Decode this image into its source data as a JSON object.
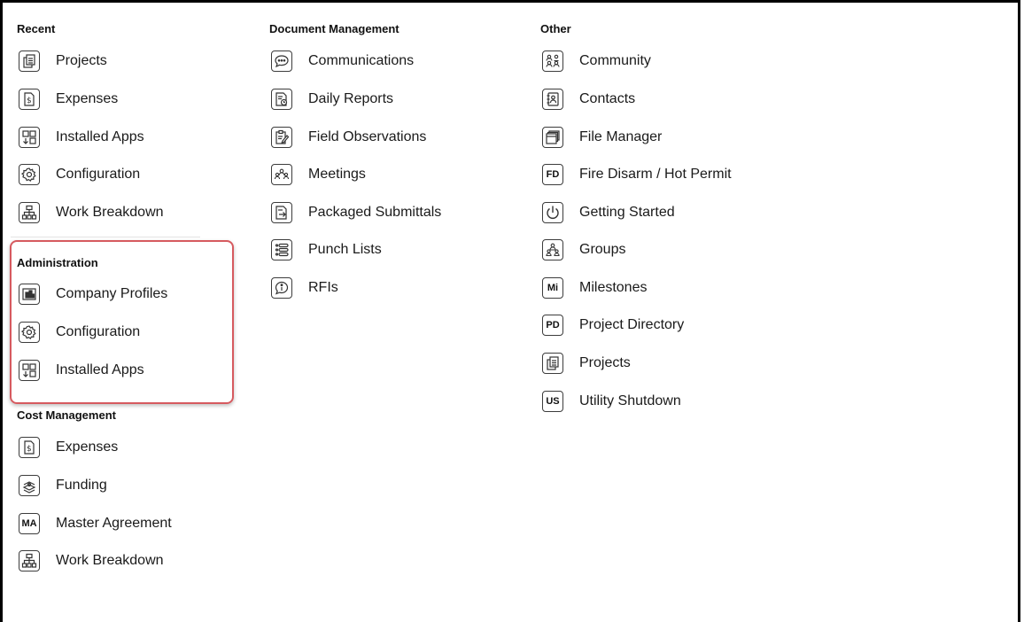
{
  "columns": {
    "recent": {
      "heading": "Recent",
      "items": [
        {
          "label": "Projects",
          "icon": "projects-icon"
        },
        {
          "label": "Expenses",
          "icon": "expenses-icon"
        },
        {
          "label": "Installed Apps",
          "icon": "installed-apps-icon"
        },
        {
          "label": "Configuration",
          "icon": "gear-icon"
        },
        {
          "label": "Work Breakdown",
          "icon": "work-breakdown-icon"
        }
      ]
    },
    "administration": {
      "heading": "Administration",
      "items": [
        {
          "label": "Company Profiles",
          "icon": "company-profiles-icon"
        },
        {
          "label": "Configuration",
          "icon": "gear-icon"
        },
        {
          "label": "Installed Apps",
          "icon": "installed-apps-icon"
        }
      ]
    },
    "cost_management": {
      "heading": "Cost Management",
      "items": [
        {
          "label": "Expenses",
          "icon": "expenses-icon"
        },
        {
          "label": "Funding",
          "icon": "funding-icon"
        },
        {
          "label": "Master Agreement",
          "icon": "text-badge-icon",
          "badge": "MA"
        },
        {
          "label": "Work Breakdown",
          "icon": "work-breakdown-icon"
        }
      ]
    },
    "document_management": {
      "heading": "Document Management",
      "items": [
        {
          "label": "Communications",
          "icon": "speech-bubble-icon"
        },
        {
          "label": "Daily Reports",
          "icon": "daily-reports-icon"
        },
        {
          "label": "Field Observations",
          "icon": "field-observations-icon"
        },
        {
          "label": "Meetings",
          "icon": "people-group-icon"
        },
        {
          "label": "Packaged Submittals",
          "icon": "packaged-submittals-icon"
        },
        {
          "label": "Punch Lists",
          "icon": "list-icon"
        },
        {
          "label": "RFIs",
          "icon": "info-bubble-icon"
        }
      ]
    },
    "other": {
      "heading": "Other",
      "items": [
        {
          "label": "Community",
          "icon": "community-icon"
        },
        {
          "label": "Contacts",
          "icon": "contacts-book-icon"
        },
        {
          "label": "File Manager",
          "icon": "file-manager-icon"
        },
        {
          "label": "Fire Disarm / Hot Permit",
          "icon": "text-badge-icon",
          "badge": "FD"
        },
        {
          "label": "Getting Started",
          "icon": "power-icon"
        },
        {
          "label": "Groups",
          "icon": "people-group-icon"
        },
        {
          "label": "Milestones",
          "icon": "text-badge-icon",
          "badge": "Mi"
        },
        {
          "label": "Project Directory",
          "icon": "text-badge-icon",
          "badge": "PD"
        },
        {
          "label": "Projects",
          "icon": "projects-icon"
        },
        {
          "label": "Utility Shutdown",
          "icon": "text-badge-icon",
          "badge": "US"
        }
      ]
    }
  },
  "highlight_color": "#d65a5f"
}
